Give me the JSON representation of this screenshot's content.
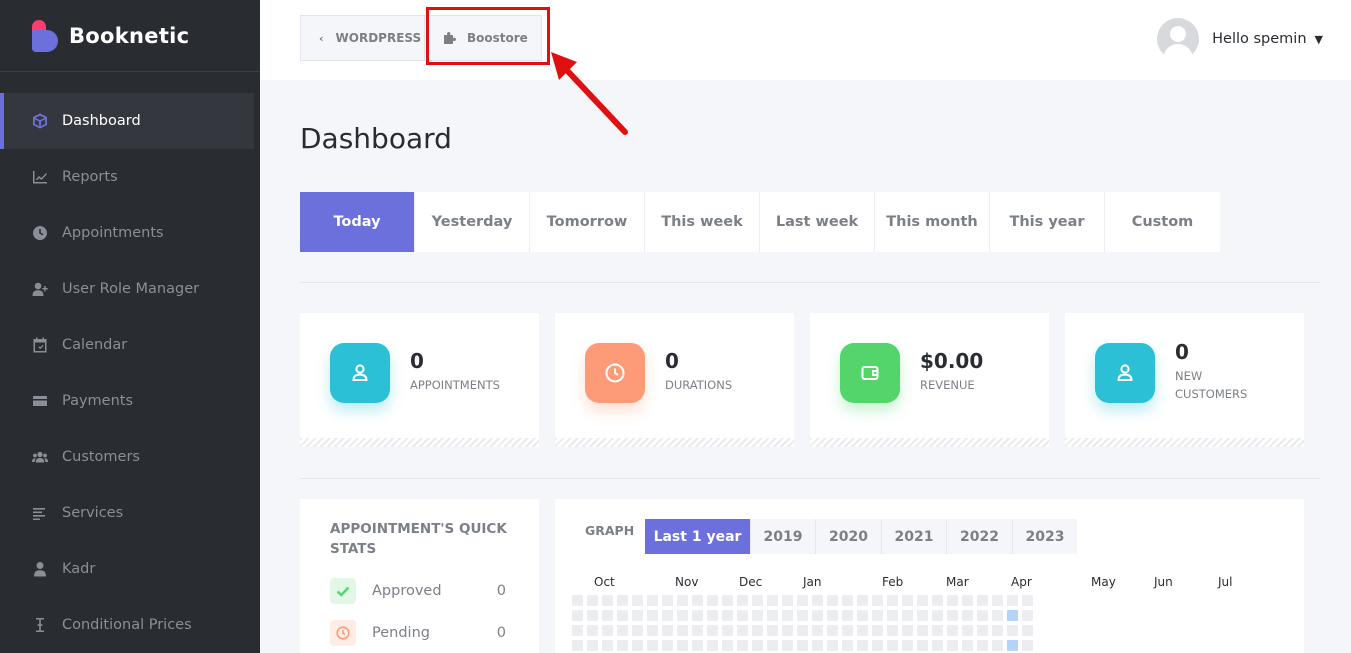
{
  "sidebar": {
    "brand": "Booknetic",
    "items": [
      {
        "label": "Dashboard",
        "icon": "cube-icon",
        "active": true
      },
      {
        "label": "Reports",
        "icon": "chart-line-icon"
      },
      {
        "label": "Appointments",
        "icon": "clock-icon"
      },
      {
        "label": "User Role Manager",
        "icon": "user-plus-icon"
      },
      {
        "label": "Calendar",
        "icon": "calendar-icon"
      },
      {
        "label": "Payments",
        "icon": "credit-card-icon"
      },
      {
        "label": "Customers",
        "icon": "users-icon"
      },
      {
        "label": "Services",
        "icon": "list-icon"
      },
      {
        "label": "Kadr",
        "icon": "user-icon"
      },
      {
        "label": "Conditional Prices",
        "icon": "i-cursor-icon"
      }
    ]
  },
  "topbar": {
    "breadcrumb_back": "WORDPRESS",
    "breadcrumb_boostore": "Boostore",
    "user_greeting": "Hello spemin",
    "accent_highlight": "#e01010"
  },
  "main": {
    "title": "Dashboard",
    "tabs": [
      "Today",
      "Yesterday",
      "Tomorrow",
      "This week",
      "Last week",
      "This month",
      "This year",
      "Custom"
    ],
    "active_tab": "Today",
    "stats": [
      {
        "value": "0",
        "label": "APPOINTMENTS",
        "color": "#2bc0d6",
        "icon": "user-icon"
      },
      {
        "value": "0",
        "label": "DURATIONS",
        "color": "#fd9b78",
        "icon": "clock-icon"
      },
      {
        "value": "$0.00",
        "label": "REVENUE",
        "color": "#53d56c",
        "icon": "wallet-icon"
      },
      {
        "value": "0",
        "label": "NEW CUSTOMERS",
        "color": "#2bc0d6",
        "icon": "user-icon"
      }
    ],
    "quick_stats": {
      "title": "APPOINTMENT'S QUICK STATS",
      "rows": [
        {
          "label": "Approved",
          "count": "0",
          "color": "#53d56c",
          "icon": "check-icon"
        },
        {
          "label": "Pending",
          "count": "0",
          "color": "#fd9b78",
          "icon": "clock-icon"
        }
      ]
    },
    "graph": {
      "title": "GRAPH",
      "year_tabs": [
        "Last 1 year",
        "2019",
        "2020",
        "2021",
        "2022",
        "2023"
      ],
      "active_year": "Last 1 year",
      "months": [
        "Oct",
        "Nov",
        "Dec",
        "Jan",
        "Feb",
        "Mar",
        "Apr",
        "May",
        "Jun",
        "Jul"
      ]
    }
  },
  "colors": {
    "primary": "#6c70dc",
    "sidebar_bg": "#292d32"
  }
}
